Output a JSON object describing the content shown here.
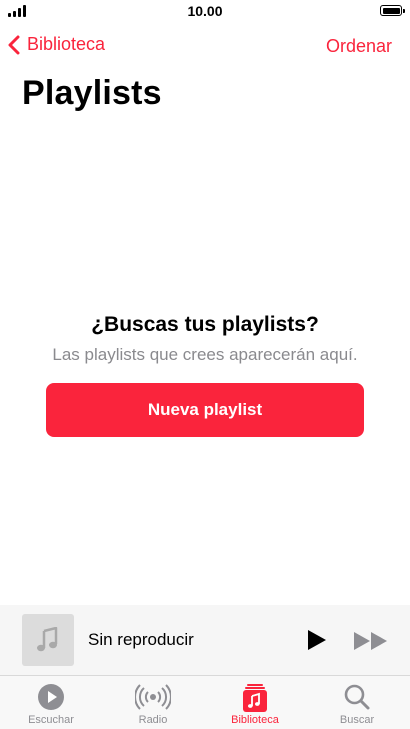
{
  "status_bar": {
    "time": "10.00"
  },
  "nav": {
    "back_label": "Biblioteca",
    "sort_label": "Ordenar"
  },
  "page": {
    "title": "Playlists"
  },
  "empty_state": {
    "heading": "¿Buscas tus playlists?",
    "subtitle": "Las playlists que crees aparecerán aquí.",
    "button_label": "Nueva playlist"
  },
  "mini_player": {
    "title": "Sin reproducir"
  },
  "tabs": [
    {
      "label": "Escuchar",
      "icon": "play-circle-icon"
    },
    {
      "label": "Radio",
      "icon": "radio-icon"
    },
    {
      "label": "Biblioteca",
      "icon": "library-icon",
      "active": true
    },
    {
      "label": "Buscar",
      "icon": "search-icon"
    }
  ],
  "colors": {
    "accent": "#fa243c",
    "inactive": "#8e8e93",
    "secondary_text": "#8a8a8e"
  }
}
